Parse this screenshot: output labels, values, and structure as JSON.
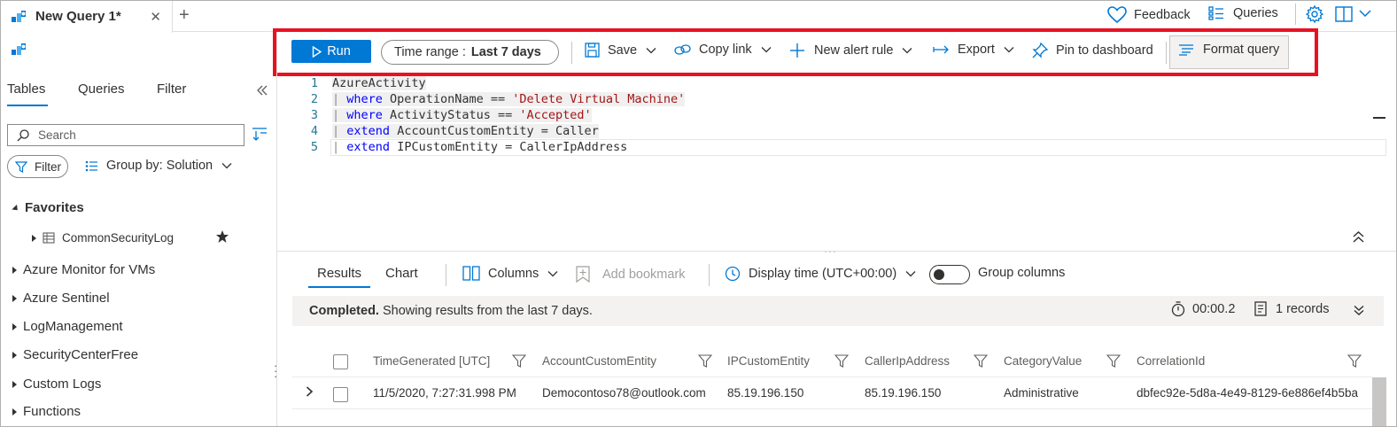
{
  "tab": {
    "title": "New Query 1*",
    "close": "✕",
    "new_tab": "+"
  },
  "top_right": {
    "feedback": "Feedback",
    "queries": "Queries"
  },
  "toolbar": {
    "run": "Run",
    "time_range_label": "Time range :",
    "time_range_value": "Last 7 days",
    "save": "Save",
    "copy_link": "Copy link",
    "new_alert_rule": "New alert rule",
    "export": "Export",
    "pin_to_dashboard": "Pin to dashboard",
    "format_query": "Format query"
  },
  "left_panel": {
    "tabs": [
      "Tables",
      "Queries",
      "Filter"
    ],
    "search_placeholder": "Search",
    "filter": "Filter",
    "group_by": "Group by: Solution",
    "favorites": "Favorites",
    "favorite_item": "CommonSecurityLog",
    "groups": [
      "Azure Monitor for VMs",
      "Azure Sentinel",
      "LogManagement",
      "SecurityCenterFree",
      "Custom Logs",
      "Functions"
    ]
  },
  "editor": {
    "line_numbers": [
      "1",
      "2",
      "3",
      "4",
      "5"
    ],
    "l1": "AzureActivity",
    "l2_kw": "where",
    "l2_a": " OperationName == ",
    "l2_str": "'Delete Virtual Machine'",
    "l3_kw": "where",
    "l3_a": " ActivityStatus == ",
    "l3_str": "'Accepted'",
    "l4_kw": "extend",
    "l4_a": " AccountCustomEntity = Caller",
    "l5_kw": "extend",
    "l5_a": " IPCustomEntity = CallerIpAddress",
    "bar": "|"
  },
  "results": {
    "tabs": [
      "Results",
      "Chart"
    ],
    "columns": "Columns",
    "add_bookmark": "Add bookmark",
    "display_time": "Display time (UTC+00:00)",
    "group_columns": "Group columns",
    "status_bold": "Completed.",
    "status_rest": " Showing results from the last 7 days.",
    "elapsed": "00:00.2",
    "records": "1 records",
    "headers": [
      "TimeGenerated [UTC]",
      "AccountCustomEntity",
      "IPCustomEntity",
      "CallerIpAddress",
      "CategoryValue",
      "CorrelationId"
    ],
    "row": [
      "11/5/2020, 7:27:31.998 PM",
      "Democontoso78@outlook.com",
      "85.19.196.150",
      "85.19.196.150",
      "Administrative",
      "dbfec92e-5d8a-4e49-8129-6e886ef4b5ba"
    ]
  },
  "colors": {
    "accent": "#0078d4",
    "highlight_border": "#e81123"
  }
}
